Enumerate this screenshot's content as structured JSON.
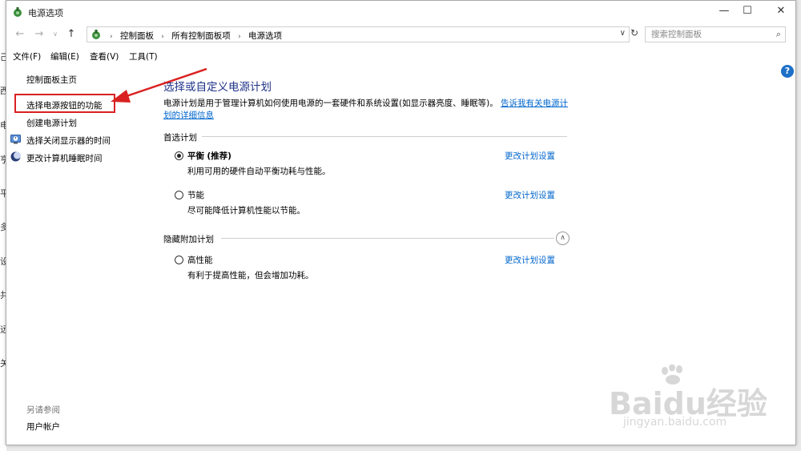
{
  "window": {
    "title": "电源选项"
  },
  "background_chars": [
    "己",
    "西",
    "电",
    "亨",
    "平",
    "多",
    "设",
    "共",
    "远",
    "关"
  ],
  "address": {
    "crumbs": [
      "控制面板",
      "所有控制面板项",
      "电源选项"
    ],
    "search_placeholder": "搜索控制面板"
  },
  "menu": [
    "文件(F)",
    "编辑(E)",
    "查看(V)",
    "工具(T)"
  ],
  "sidebar": {
    "home": "控制面板主页",
    "links": [
      "选择电源按钮的功能",
      "创建电源计划",
      "选择关闭显示器的时间",
      "更改计算机睡眠时间"
    ],
    "see_also_title": "另请参阅",
    "see_also": [
      "用户帐户"
    ]
  },
  "main": {
    "title": "选择或自定义电源计划",
    "description": "电源计划是用于管理计算机如何使用电源的一套硬件和系统设置(如显示器亮度、睡眠等)。",
    "learn_more": "告诉我有关电源计划的详细信息",
    "preferred_title": "首选计划",
    "hidden_title": "隐藏附加计划",
    "change_link": "更改计划设置",
    "plans": [
      {
        "name": "平衡",
        "tag": "(推荐)",
        "desc": "利用可用的硬件自动平衡功耗与性能。",
        "selected": true
      },
      {
        "name": "节能",
        "tag": "",
        "desc": "尽可能降低计算机性能以节能。",
        "selected": false
      }
    ],
    "hidden_plans": [
      {
        "name": "高性能",
        "desc": "有利于提高性能，但会增加功耗。",
        "selected": false
      }
    ]
  },
  "watermark": {
    "brand": "Bai",
    "brand2": "du",
    "cn": "经验",
    "url": "jingyan.baidu.com"
  },
  "colors": {
    "title_blue": "#1e3287",
    "link_blue": "#0066cc",
    "highlight_red": "#d92121"
  }
}
